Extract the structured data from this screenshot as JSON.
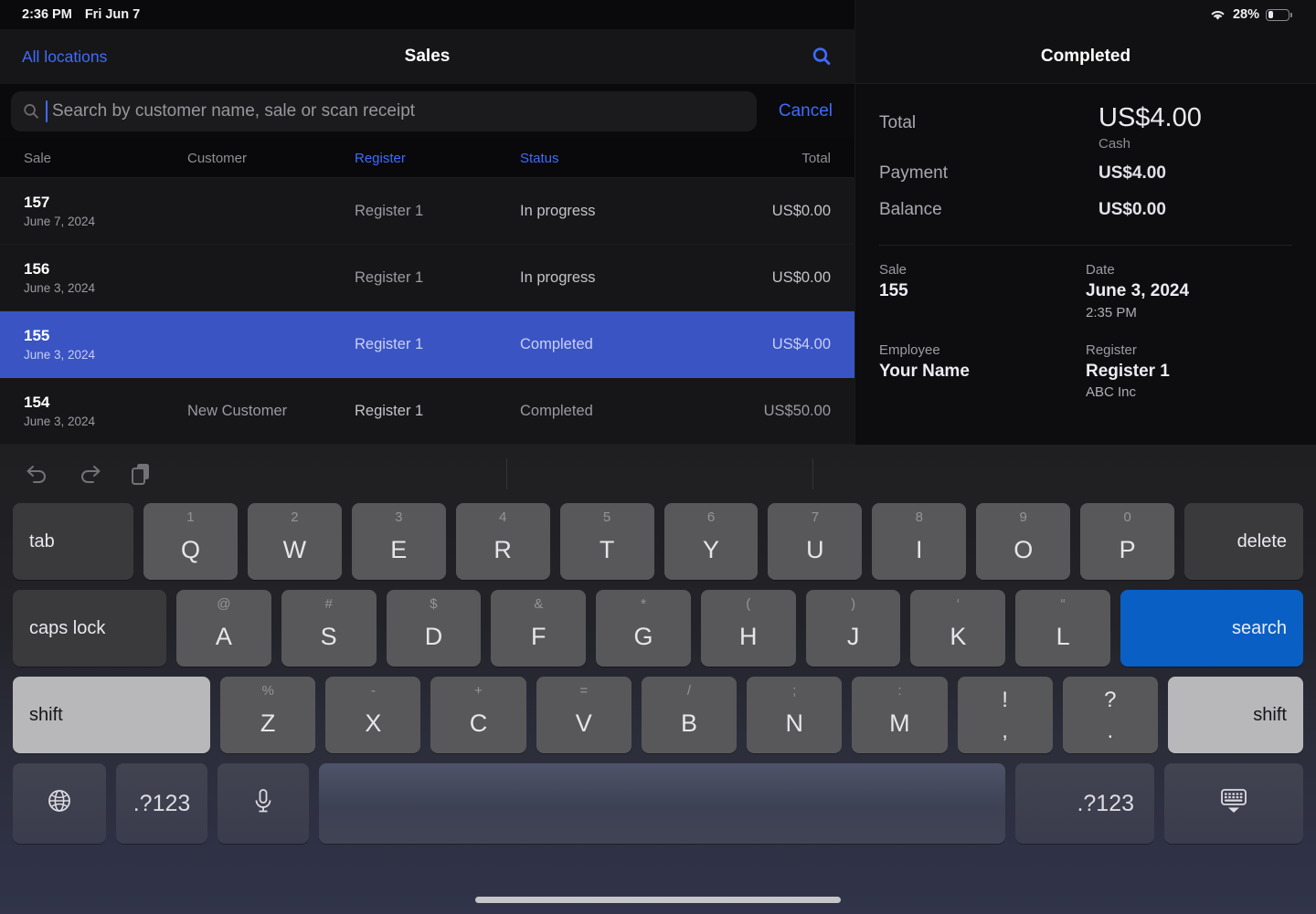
{
  "status_bar": {
    "time": "2:36 PM",
    "date": "Fri Jun 7",
    "battery_percent": "28%",
    "wifi_icon": "wifi-icon",
    "battery_icon": "battery-icon",
    "battery_level": 28
  },
  "nav": {
    "left_label": "All locations",
    "title": "Sales",
    "search_icon": "search-icon"
  },
  "search": {
    "placeholder": "Search by customer name, sale or scan receipt",
    "value": "",
    "cancel_label": "Cancel",
    "icon": "magnifier-icon"
  },
  "table": {
    "columns": [
      {
        "label": "Sale",
        "active": false
      },
      {
        "label": "Customer",
        "active": false
      },
      {
        "label": "Register",
        "active": true
      },
      {
        "label": "Status",
        "active": true
      },
      {
        "label": "Total",
        "active": false
      }
    ],
    "rows": [
      {
        "sale": "157",
        "date": "June 7, 2024",
        "customer": "",
        "register": "Register 1",
        "status": "In progress",
        "total": "US$0.00",
        "selected": false
      },
      {
        "sale": "156",
        "date": "June 3, 2024",
        "customer": "",
        "register": "Register 1",
        "status": "In progress",
        "total": "US$0.00",
        "selected": false
      },
      {
        "sale": "155",
        "date": "June 3, 2024",
        "customer": "",
        "register": "Register 1",
        "status": "Completed",
        "total": "US$4.00",
        "selected": true
      },
      {
        "sale": "154",
        "date": "June 3, 2024",
        "customer": "New Customer",
        "register": "Register 1",
        "status": "Completed",
        "total": "US$50.00",
        "selected": false
      }
    ]
  },
  "detail": {
    "title": "Completed",
    "total_label": "Total",
    "total_value": "US$4.00",
    "total_method": "Cash",
    "payment_label": "Payment",
    "payment_value": "US$4.00",
    "balance_label": "Balance",
    "balance_value": "US$0.00",
    "meta": [
      {
        "label": "Sale",
        "value": "155",
        "sub": ""
      },
      {
        "label": "Date",
        "value": "June 3, 2024",
        "sub": "2:35 PM"
      },
      {
        "label": "Employee",
        "value": "Your Name",
        "sub": ""
      },
      {
        "label": "Register",
        "value": "Register 1",
        "sub": "ABC Inc"
      }
    ]
  },
  "keyboard": {
    "toolbar": [
      {
        "name": "undo-icon",
        "label": "undo"
      },
      {
        "name": "redo-icon",
        "label": "redo"
      },
      {
        "name": "paste-icon",
        "label": "paste"
      }
    ],
    "row1": {
      "tab": "tab",
      "keys": [
        {
          "hint": "1",
          "letter": "Q"
        },
        {
          "hint": "2",
          "letter": "W"
        },
        {
          "hint": "3",
          "letter": "E"
        },
        {
          "hint": "4",
          "letter": "R"
        },
        {
          "hint": "5",
          "letter": "T"
        },
        {
          "hint": "6",
          "letter": "Y"
        },
        {
          "hint": "7",
          "letter": "U"
        },
        {
          "hint": "8",
          "letter": "I"
        },
        {
          "hint": "9",
          "letter": "O"
        },
        {
          "hint": "0",
          "letter": "P"
        }
      ],
      "delete": "delete"
    },
    "row2": {
      "caps": "caps lock",
      "keys": [
        {
          "hint": "@",
          "letter": "A"
        },
        {
          "hint": "#",
          "letter": "S"
        },
        {
          "hint": "$",
          "letter": "D"
        },
        {
          "hint": "&",
          "letter": "F"
        },
        {
          "hint": "*",
          "letter": "G"
        },
        {
          "hint": "(",
          "letter": "H"
        },
        {
          "hint": ")",
          "letter": "J"
        },
        {
          "hint": "‘",
          "letter": "K"
        },
        {
          "hint": "“",
          "letter": "L"
        }
      ],
      "search": "search"
    },
    "row3": {
      "shift_left": "shift",
      "keys": [
        {
          "hint": "%",
          "letter": "Z"
        },
        {
          "hint": "-",
          "letter": "X"
        },
        {
          "hint": "+",
          "letter": "C"
        },
        {
          "hint": "=",
          "letter": "V"
        },
        {
          "hint": "/",
          "letter": "B"
        },
        {
          "hint": ";",
          "letter": "N"
        },
        {
          "hint": ":",
          "letter": "M"
        }
      ],
      "punc": [
        {
          "top": "!",
          "bot": ","
        },
        {
          "top": "?",
          "bot": "."
        }
      ],
      "shift_right": "shift"
    },
    "row4": {
      "globe": "globe-icon",
      "num_left": ".?123",
      "mic": "microphone-icon",
      "space": "",
      "num_right": ".?123",
      "dismiss": "dismiss-keyboard-icon"
    }
  },
  "colors": {
    "accent_blue": "#3f6bff",
    "selection_blue": "#3a54c4",
    "search_key_blue": "#0a5fc4",
    "background": "#0d0d0f"
  }
}
